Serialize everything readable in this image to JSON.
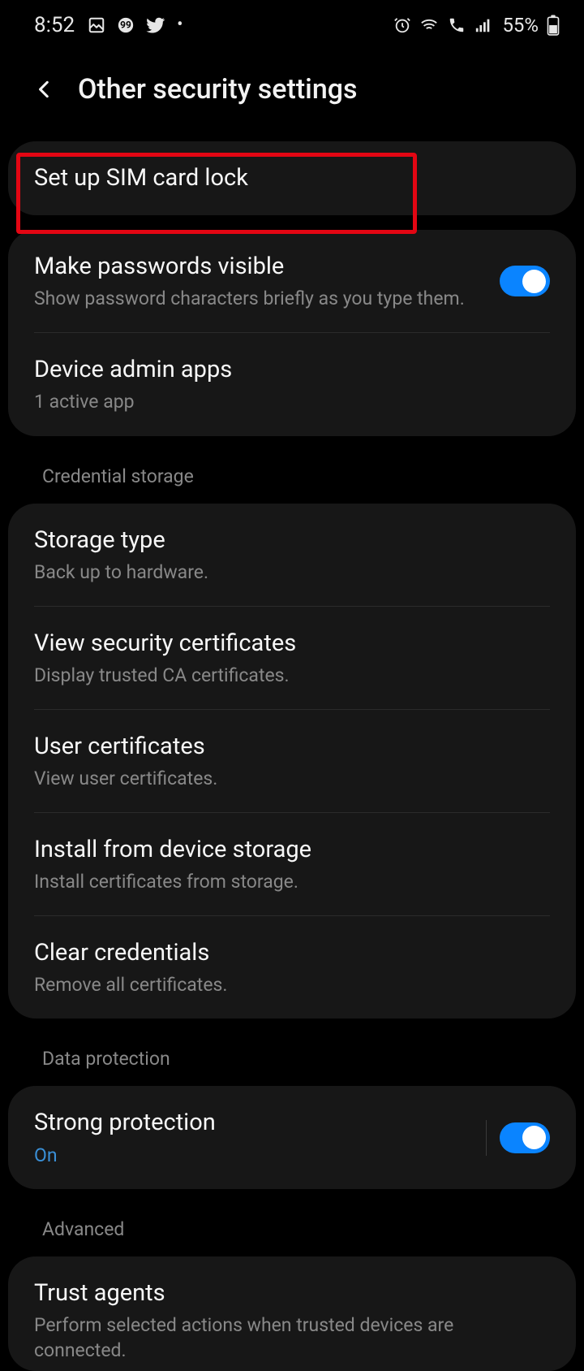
{
  "status": {
    "time": "8:52",
    "battery": "55%"
  },
  "header": {
    "title": "Other security settings"
  },
  "group1": {
    "sim": {
      "title": "Set up SIM card lock"
    }
  },
  "group2": {
    "pwvis": {
      "title": "Make passwords visible",
      "sub": "Show password characters briefly as you type them."
    },
    "admin": {
      "title": "Device admin apps",
      "sub": "1 active app"
    }
  },
  "section_cred": "Credential storage",
  "group3": {
    "storage": {
      "title": "Storage type",
      "sub": "Back up to hardware."
    },
    "viewcerts": {
      "title": "View security certificates",
      "sub": "Display trusted CA certificates."
    },
    "usercerts": {
      "title": "User certificates",
      "sub": "View user certificates."
    },
    "install": {
      "title": "Install from device storage",
      "sub": "Install certificates from storage."
    },
    "clear": {
      "title": "Clear credentials",
      "sub": "Remove all certificates."
    }
  },
  "section_data": "Data protection",
  "group4": {
    "strong": {
      "title": "Strong protection",
      "sub": "On"
    }
  },
  "section_adv": "Advanced",
  "group5": {
    "trust": {
      "title": "Trust agents",
      "sub": "Perform selected actions when trusted devices are connected."
    }
  }
}
